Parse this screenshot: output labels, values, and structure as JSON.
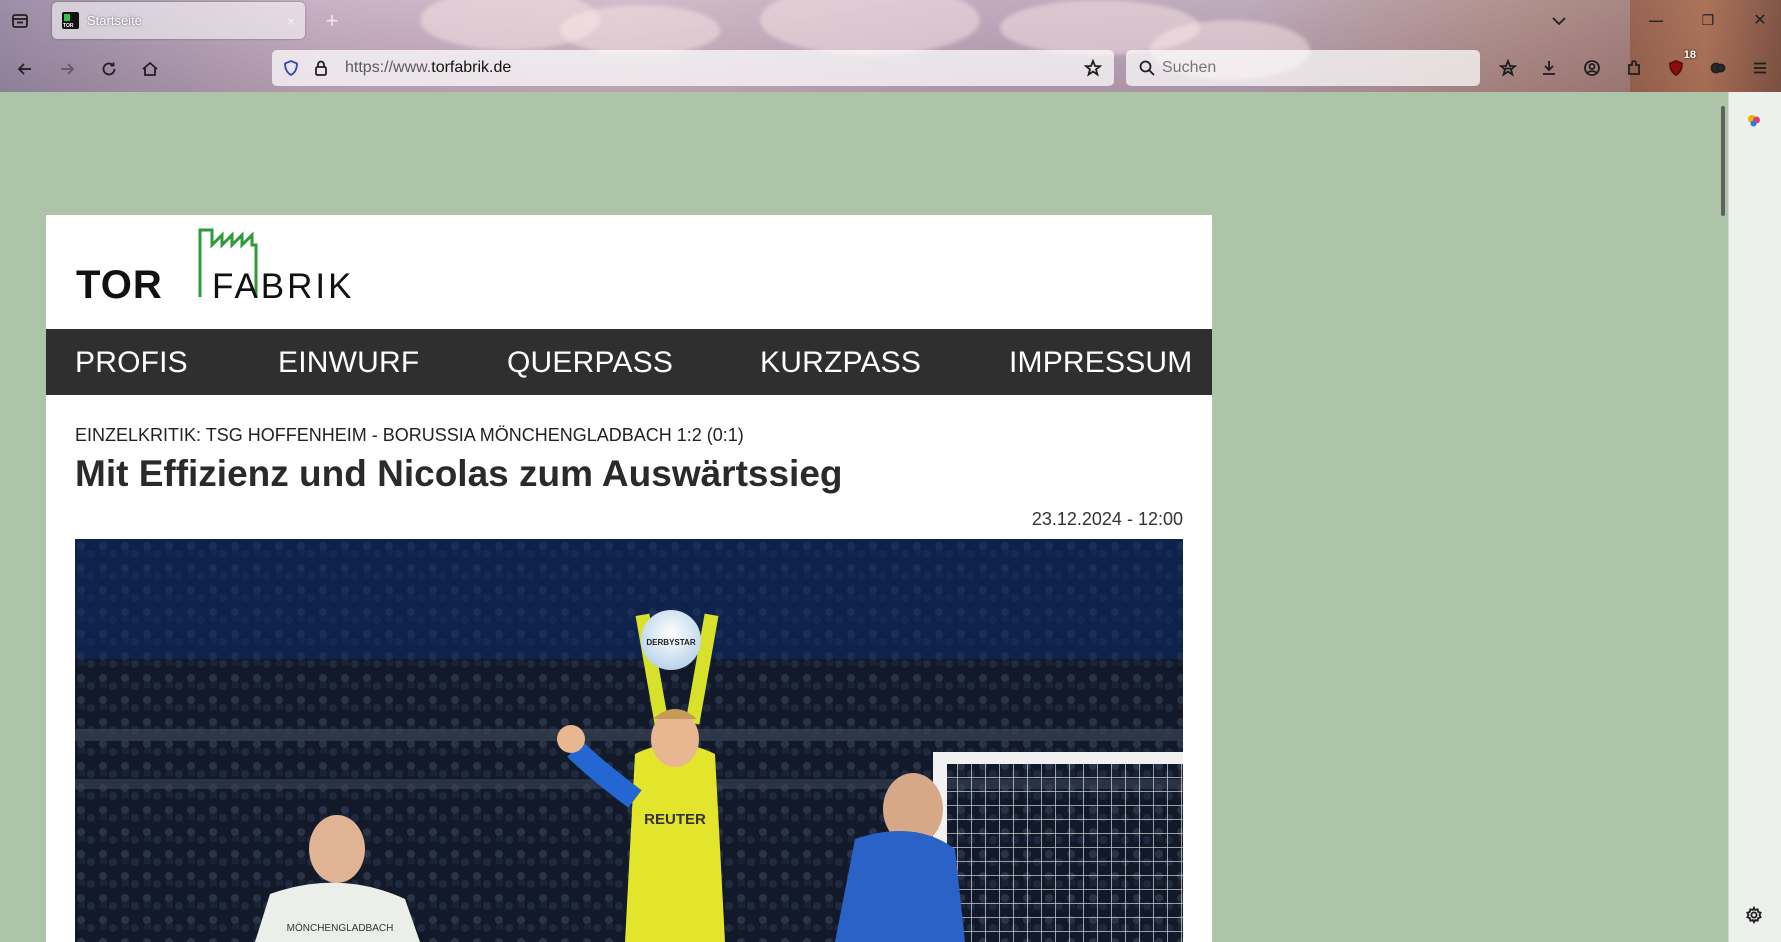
{
  "browser": {
    "tab_title": "Startseite",
    "tab_close": "×",
    "new_tab": "+",
    "url_prefix": "https://www.",
    "url_domain": "torfabrik.de",
    "search_placeholder": "Suchen",
    "extension_badge": "18",
    "window_controls": {
      "minimize": "—",
      "restore": "❐",
      "close": "✕"
    }
  },
  "site": {
    "logo_left": "TOR",
    "logo_right": "FABRIK",
    "menu": [
      "PROFIS",
      "EINWURF",
      "QUERPASS",
      "KURZPASS",
      "IMPRESSUM"
    ]
  },
  "article": {
    "kicker": "EINZELKRITIK: TSG HOFFENHEIM - BORUSSIA MÖNCHENGLADBACH 1:2 (0:1)",
    "headline": "Mit Effizienz und Nicolas zum Auswärtssieg",
    "date": "23.12.2024 - 12:00",
    "photo": {
      "ball_text": "DERBYSTAR",
      "jersey_sponsor": "REUTER",
      "shirt_text": "MÖNCHENGLADBACH"
    }
  },
  "colors": {
    "page_background": "#aec4a8",
    "menu_background": "#2f2f2f",
    "logo_green": "#2e9a3a"
  }
}
